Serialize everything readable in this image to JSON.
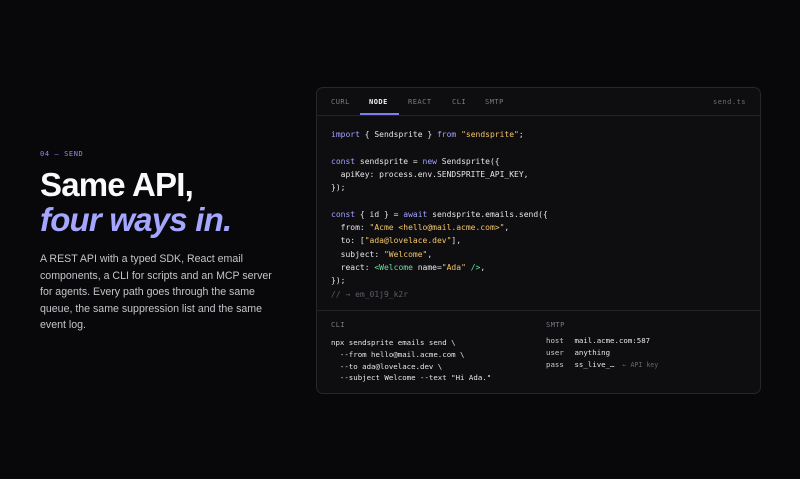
{
  "left": {
    "eyebrow": "04 — SEND",
    "headline": "Same API,",
    "headline_accent": "four ways in.",
    "description": "A REST API with a typed SDK, React email components, a CLI for scripts and an MCP server for agents. Every path goes through the same queue, the same suppression list and the same event log."
  },
  "panel": {
    "tabs": [
      {
        "label": "CURL",
        "active": false
      },
      {
        "label": "NODE",
        "active": true
      },
      {
        "label": "REACT",
        "active": false
      },
      {
        "label": "CLI",
        "active": false
      },
      {
        "label": "SMTP",
        "active": false
      }
    ],
    "filename": "send.ts",
    "code": {
      "l1_import": "import",
      "l1_names": " { Sendsprite } ",
      "l1_from": "from",
      "l1_mod": "\"sendsprite\"",
      "l1_end": ";",
      "l3_const": "const",
      "l3_mid": " sendsprite = ",
      "l3_new": "new",
      "l3_end": " Sendsprite({",
      "l4": "  apiKey: process.env.SENDSPRITE_API_KEY,",
      "l5": "});",
      "l7_const": "const",
      "l7_mid": " { id } = ",
      "l7_await": "await",
      "l7_end": " sendsprite.emails.send({",
      "l8_key": "  from: ",
      "l8_val": "\"Acme <hello@mail.acme.com>\"",
      "l8_end": ",",
      "l9_key": "  to: [",
      "l9_val": "\"ada@lovelace.dev\"",
      "l9_end": "],",
      "l10_key": "  subject: ",
      "l10_val": "\"Welcome\"",
      "l10_end": ",",
      "l11_key": "  react: ",
      "l11_tag_open": "<Welcome",
      "l11_attr": " name=",
      "l11_attr_val": "\"Ada\"",
      "l11_tag_close": " />",
      "l11_end": ",",
      "l12": "});",
      "l13": "// → em_01j9_k2r"
    },
    "cli": {
      "label": "CLI",
      "lines": [
        "npx sendsprite emails send \\",
        "  --from hello@mail.acme.com \\",
        "  --to ada@lovelace.dev \\",
        "  --subject Welcome --text \"Hi Ada.\""
      ]
    },
    "smtp": {
      "label": "SMTP",
      "rows": [
        {
          "key": "host",
          "value": "mail.acme.com:587",
          "hint": ""
        },
        {
          "key": "user",
          "value": "anything",
          "hint": ""
        },
        {
          "key": "pass",
          "value": "ss_live_…",
          "hint": "← API key"
        }
      ]
    }
  },
  "colors": {
    "background": "#08080a",
    "accent": "#a4a6ff",
    "string": "#f4c56a",
    "jsx_tag": "#6fdca0"
  }
}
